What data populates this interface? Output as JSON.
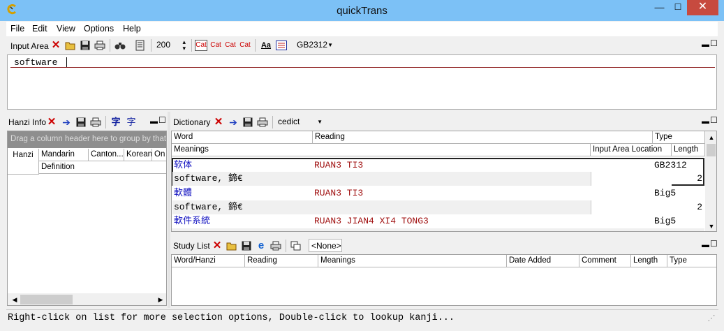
{
  "window": {
    "title": "quickTrans",
    "minimize_glyph": "—",
    "maximize_glyph": "☐",
    "close_glyph": "✕"
  },
  "menu": {
    "file": "File",
    "edit": "Edit",
    "view": "View",
    "options": "Options",
    "help": "Help"
  },
  "input_toolbar": {
    "label": "Input Area",
    "font_size": "200",
    "encoding": "GB2312",
    "cat_buttons": [
      "Cat",
      "Cat",
      "Cat",
      "Cat"
    ],
    "aa_label": "Aa"
  },
  "input_area": {
    "value": "software"
  },
  "hanzi_panel": {
    "label": "Hanzi Info",
    "group_hint": "Drag a column header here to group by that col",
    "columns": {
      "hanzi": "Hanzi",
      "mandarin": "Mandarin",
      "cantonese": "Canton...",
      "korean": "Korean",
      "on": "On",
      "definition": "Definition"
    }
  },
  "dictionary": {
    "label": "Dictionary",
    "dict_name": "cedict",
    "columns": {
      "word": "Word",
      "reading": "Reading",
      "type": "Type",
      "meanings": "Meanings",
      "location": "Input Area Location",
      "length": "Length"
    },
    "entries": [
      {
        "word": "软体",
        "reading": "RUAN3 TI3",
        "type": "GB2312",
        "meaning": "software, 鍗€",
        "length": "2"
      },
      {
        "word": "軟體",
        "reading": "RUAN3 TI3",
        "type": "Big5",
        "meaning": "software, 鍗€",
        "length": "2"
      },
      {
        "word": "軟件系統",
        "reading": "RUAN3 JIAN4 XI4 TONG3",
        "type": "Big5",
        "meaning": "",
        "length": ""
      }
    ]
  },
  "study_list": {
    "label": "Study List",
    "filter": "<None>",
    "columns": {
      "word": "Word/Hanzi",
      "reading": "Reading",
      "meanings": "Meanings",
      "date": "Date Added",
      "comment": "Comment",
      "length": "Length",
      "type": "Type"
    }
  },
  "status": {
    "text": "Right-click on list for more selection options, Double-click to lookup kanji..."
  },
  "colors": {
    "titlebar": "#7cc1f6",
    "close": "#c74a3f",
    "word_blue": "#1010c0",
    "reading_red": "#a01010"
  }
}
